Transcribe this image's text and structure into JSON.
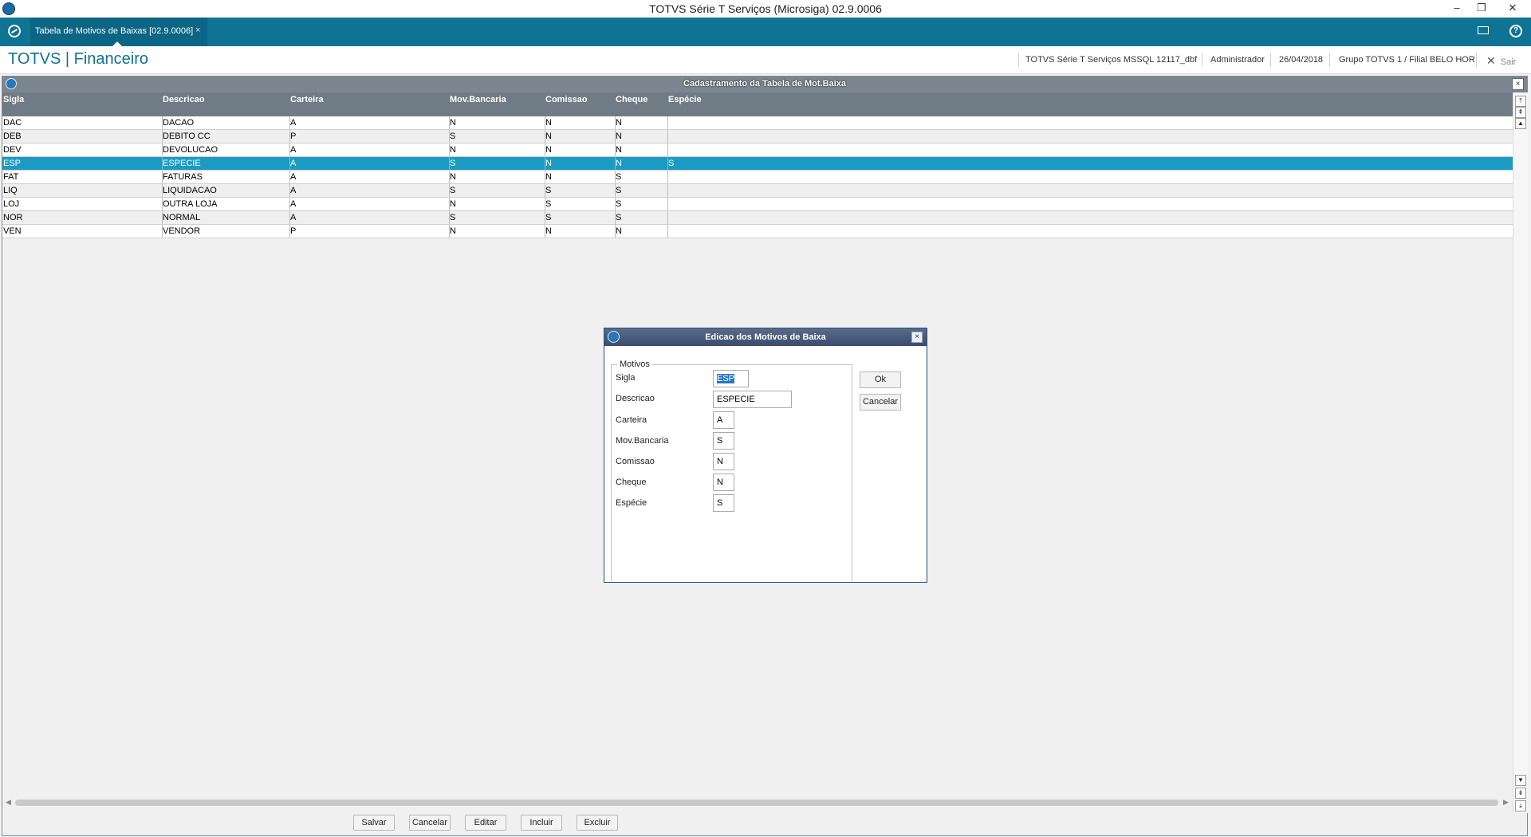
{
  "app": {
    "window_title": "TOTVS Série T Serviços (Microsiga) 02.9.0006",
    "tab_label": "Tabela de Motivos de Baixas [02.9.0006]",
    "tab_close": "×",
    "brand": "TOTVS | Financeiro",
    "environment": "TOTVS Série T Serviços MSSQL 12117_dbf",
    "user": "Administrador",
    "date": "26/04/2018",
    "branch": "Grupo TOTVS 1 / Filial BELO HOR",
    "exit_label": "Sair",
    "minimize": "–",
    "restore": "❐",
    "close": "✕"
  },
  "main_window": {
    "title": "Cadastramento da Tabela de Mot.Baixa",
    "close": "×"
  },
  "grid": {
    "columns": [
      "Sigla",
      "Descricao",
      "Carteira",
      "Mov.Bancaria",
      "Comissao",
      "Cheque",
      "Espécie"
    ],
    "rows": [
      {
        "sigla": "DAC",
        "descricao": "DACAO",
        "carteira": "A",
        "mov": "N",
        "comissao": "N",
        "cheque": "N",
        "especie": ""
      },
      {
        "sigla": "DEB",
        "descricao": "DEBITO CC",
        "carteira": "P",
        "mov": "S",
        "comissao": "N",
        "cheque": "N",
        "especie": ""
      },
      {
        "sigla": "DEV",
        "descricao": "DEVOLUCAO",
        "carteira": "A",
        "mov": "N",
        "comissao": "N",
        "cheque": "N",
        "especie": ""
      },
      {
        "sigla": "ESP",
        "descricao": "ESPECIE",
        "carteira": "A",
        "mov": "S",
        "comissao": "N",
        "cheque": "N",
        "especie": "S"
      },
      {
        "sigla": "FAT",
        "descricao": "FATURAS",
        "carteira": "A",
        "mov": "N",
        "comissao": "N",
        "cheque": "S",
        "especie": ""
      },
      {
        "sigla": "LIQ",
        "descricao": "LIQUIDACAO",
        "carteira": "A",
        "mov": "S",
        "comissao": "S",
        "cheque": "S",
        "especie": ""
      },
      {
        "sigla": "LOJ",
        "descricao": "OUTRA LOJA",
        "carteira": "A",
        "mov": "N",
        "comissao": "S",
        "cheque": "S",
        "especie": ""
      },
      {
        "sigla": "NOR",
        "descricao": "NORMAL",
        "carteira": "A",
        "mov": "S",
        "comissao": "S",
        "cheque": "S",
        "especie": ""
      },
      {
        "sigla": "VEN",
        "descricao": "VENDOR",
        "carteira": "P",
        "mov": "N",
        "comissao": "N",
        "cheque": "N",
        "especie": ""
      }
    ],
    "selected_sigla": "ESP"
  },
  "scroll": {
    "top": "⤒",
    "page_up": "⇞",
    "up": "▲",
    "down": "▼",
    "page_down": "⇟",
    "bottom": "⤓",
    "left": "◀",
    "right": "▶"
  },
  "bottom_buttons": {
    "save": "Salvar",
    "cancel": "Cancelar",
    "edit": "Editar",
    "include": "Incluir",
    "delete": "Excluir"
  },
  "dialog": {
    "title": "Edicao dos Motivos de Baixa",
    "close": "×",
    "group_label": "Motivos",
    "fields": {
      "sigla": {
        "label": "Sigla",
        "value": "ESP"
      },
      "descricao": {
        "label": "Descricao",
        "value": "ESPECIE"
      },
      "carteira": {
        "label": "Carteira",
        "value": "A"
      },
      "mov": {
        "label": "Mov.Bancaria",
        "value": "S"
      },
      "comissao": {
        "label": "Comissao",
        "value": "N"
      },
      "cheque": {
        "label": "Cheque",
        "value": "N"
      },
      "especie": {
        "label": "Espécie",
        "value": "S"
      }
    },
    "ok_label": "Ok",
    "cancel_label": "Cancelar"
  },
  "colors": {
    "accent": "#0f7394",
    "selected_row": "#1b9bc2",
    "grid_header": "#6f7b85"
  }
}
